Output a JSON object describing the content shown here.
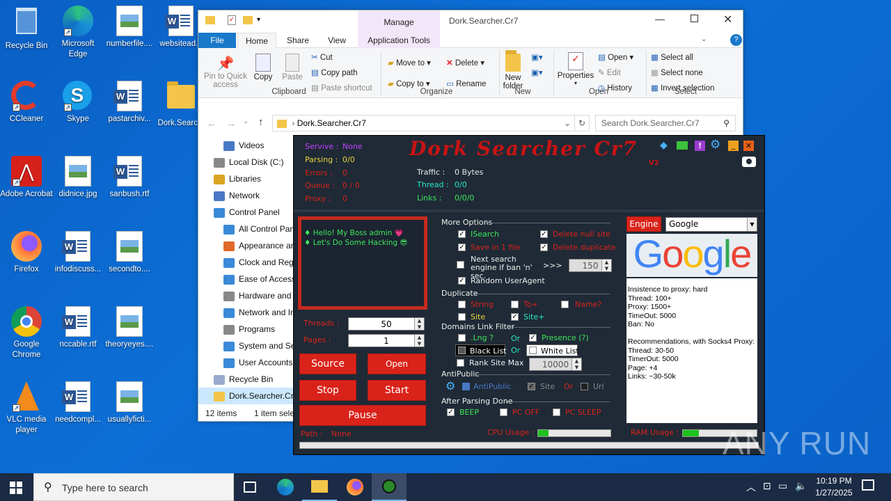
{
  "desktop": {
    "icons": [
      {
        "label": "Recycle Bin",
        "icon": "recycle-bin-icon"
      },
      {
        "label": "Microsoft Edge",
        "icon": "edge-icon"
      },
      {
        "label": "numberfile....",
        "icon": "image-file-icon"
      },
      {
        "label": "websitead...",
        "icon": "word-doc-icon"
      },
      {
        "label": "CCleaner",
        "icon": "ccleaner-icon"
      },
      {
        "label": "Skype",
        "icon": "skype-icon"
      },
      {
        "label": "pastarchiv...",
        "icon": "word-doc-icon"
      },
      {
        "label": "Dork.Searc...",
        "icon": "folder-icon"
      },
      {
        "label": "Adobe Acrobat",
        "icon": "acrobat-icon"
      },
      {
        "label": "didnice.jpg",
        "icon": "image-file-icon"
      },
      {
        "label": "sanbush.rtf",
        "icon": "word-doc-icon"
      },
      {
        "label": "Firefox",
        "icon": "firefox-icon"
      },
      {
        "label": "infodiscuss...",
        "icon": "word-doc-icon"
      },
      {
        "label": "secondto....",
        "icon": "image-file-icon"
      },
      {
        "label": "Google Chrome",
        "icon": "chrome-icon"
      },
      {
        "label": "nccable.rtf",
        "icon": "word-doc-icon"
      },
      {
        "label": "theoryeyes....",
        "icon": "image-file-icon"
      },
      {
        "label": "VLC media player",
        "icon": "vlc-icon"
      },
      {
        "label": "needcompl...",
        "icon": "word-doc-icon"
      },
      {
        "label": "usuallyficti...",
        "icon": "image-file-icon"
      }
    ]
  },
  "explorer": {
    "title": "Dork.Searcher.Cr7",
    "manage_tab": "Manage",
    "tabs": {
      "file": "File",
      "home": "Home",
      "share": "Share",
      "view": "View",
      "app_tools": "Application Tools"
    },
    "ribbon": {
      "pin": "Pin to Quick access",
      "copy": "Copy",
      "paste": "Paste",
      "cut": "Cut",
      "copy_path": "Copy path",
      "paste_shortcut": "Paste shortcut",
      "move_to": "Move to",
      "copy_to": "Copy to",
      "delete": "Delete",
      "rename": "Rename",
      "new_folder": "New folder",
      "properties": "Properties",
      "open": "Open",
      "edit": "Edit",
      "history": "History",
      "select_all": "Select all",
      "select_none": "Select none",
      "invert_selection": "Invert selection",
      "groups": {
        "clipboard": "Clipboard",
        "organize": "Organize",
        "new": "New",
        "open": "Open",
        "select": "Select"
      }
    },
    "address": "Dork.Searcher.Cr7",
    "search_placeholder": "Search Dork.Searcher.Cr7",
    "nav": [
      "Videos",
      "Local Disk (C:)",
      "Libraries",
      "Network",
      "Control Panel",
      "All Control Pan",
      "Appearance and",
      "Clock and Regi",
      "Ease of Access",
      "Hardware and",
      "Network and In",
      "Programs",
      "System and Sec",
      "User Accounts",
      "Recycle Bin",
      "Dork.Searcher.Cr"
    ],
    "status_items": "12 items",
    "status_selected": "1 item selec"
  },
  "app": {
    "title": "Dork Searcher Cr7",
    "version": "V2",
    "stats": {
      "servive_label": "Servive :",
      "servive_value": "None",
      "parsing_label": "Parsing :",
      "parsing_value": "0/0",
      "errors_label": "Errors :",
      "errors_value": "0",
      "queue_label": "Queue :",
      "queue_value": "0 / 0",
      "proxy_label": "Proxy :",
      "proxy_value": "0",
      "traffic_label": "Traffic :",
      "traffic_value": "0 Bytes",
      "thread_label": "Thread :",
      "thread_value": "0/0",
      "links_label": "Links :",
      "links_value": "0/0/0"
    },
    "log": [
      "Hello! My Boss admin 💗",
      "Let's Do Some Hacking 😎"
    ],
    "threads_label": "Threads :",
    "threads_value": "50",
    "pages_label": "Pages :",
    "pages_value": "1",
    "source": "Source",
    "open": "Open",
    "stop": "Stop",
    "start": "Start",
    "pause": "Pause",
    "path_label": "Path :",
    "path_value": "None",
    "cpu_label": "CPU Usage :",
    "ram_label": "RAM Usage :",
    "cpu_pct": 0.14,
    "ram_pct": 0.22,
    "more_options": "More Options",
    "isearch": "ISearch",
    "save_in_1_file": "Save in 1 file",
    "delete_null_site": "Delete null site",
    "delete_duplicate": "Delete duplicate",
    "next_engine": "Next search engine if ban 'n' sec.",
    "next_engine_arrows": ">>>",
    "next_engine_value": "150",
    "random_ua": "Random UserAgent",
    "duplicate": "Duplicate",
    "string": "String",
    "to_plus": "To+",
    "name_q": "Name?",
    "site": "Site",
    "site_plus": "Site+",
    "domains_filter": "Domains  Link Filter",
    "lng": ".Lng ?",
    "or1": "Or",
    "presence": "Presence (?)",
    "black_list": "Black List",
    "or2": "Or",
    "white_list": "White List",
    "rank_max": "Rank Site Max",
    "rank_value": "10000",
    "antipublic": "AntiPublic",
    "antipublic_opt": "AntiPublic",
    "ap_site": "Site",
    "ap_or": "Or",
    "ap_url": "Url",
    "after_parsing": "After Parsing Done",
    "beep": "BEEP",
    "pc_off": "PC OFF",
    "pc_sleep": "PC SLEEP",
    "engine_btn": "Engine",
    "engine_value": "Google",
    "google_logo": "Google",
    "info": [
      "Insistence to proxy: hard",
      "Thread: 100+",
      "Proxy: 1500+",
      "TimeOut: 5000",
      "Ban: No",
      "",
      "Recommendations, with Socks4 Proxy:",
      "Thread: 30-50",
      "TimerOut: 5000",
      "Page: +4",
      "Links: ~30-50k"
    ]
  },
  "taskbar": {
    "search_placeholder": "Type here to search",
    "time": "10:19 PM",
    "date": "1/27/2025"
  },
  "watermark": "ANY RUN"
}
